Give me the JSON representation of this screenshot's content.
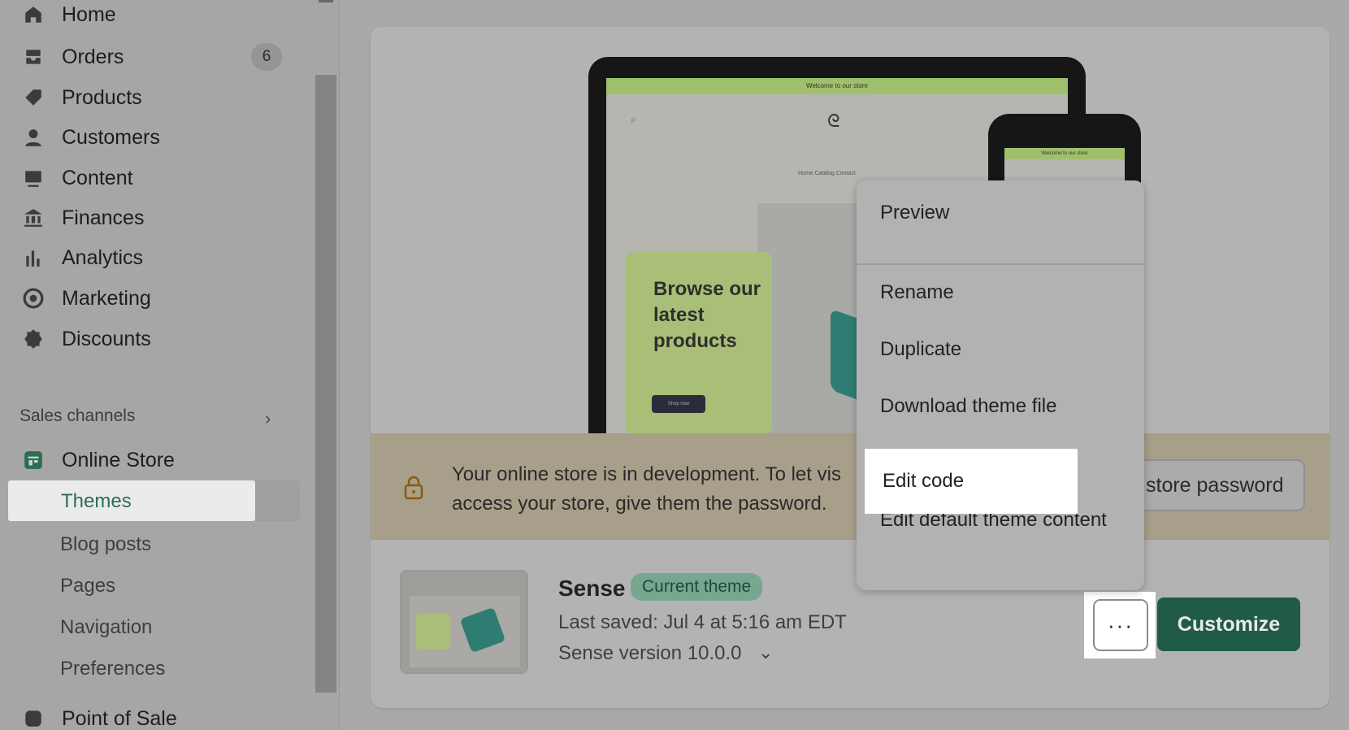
{
  "sidebar": {
    "items": [
      {
        "label": "Home",
        "icon": "home-icon"
      },
      {
        "label": "Orders",
        "icon": "inbox-icon",
        "badge": "6"
      },
      {
        "label": "Products",
        "icon": "tag-icon"
      },
      {
        "label": "Customers",
        "icon": "person-icon"
      },
      {
        "label": "Content",
        "icon": "image-icon"
      },
      {
        "label": "Finances",
        "icon": "bank-icon"
      },
      {
        "label": "Analytics",
        "icon": "bar-chart-icon"
      },
      {
        "label": "Marketing",
        "icon": "target-icon"
      },
      {
        "label": "Discounts",
        "icon": "discount-icon"
      }
    ],
    "sales_channels_label": "Sales channels",
    "online_store_label": "Online Store",
    "sub_items": [
      "Themes",
      "Blog posts",
      "Pages",
      "Navigation",
      "Preferences"
    ],
    "cut_off_item": "Point of Sale"
  },
  "preview": {
    "banner_text": "Welcome to our store",
    "phone_banner_text": "Welcome to our store",
    "nav_text": "Home   Catalog   Contact",
    "promo_text": "Browse our latest products",
    "shop_button": "Shop now"
  },
  "dev_banner": {
    "text_line1": "Your online store is in development. To let vis",
    "text_line2": "access your store, give them the password.",
    "button_label": "store password"
  },
  "theme": {
    "name": "Sense",
    "badge": "Current theme",
    "last_saved": "Last saved: Jul 4 at 5:16 am EDT",
    "version": "Sense version 10.0.0",
    "more_label": "···",
    "customize_label": "Customize"
  },
  "menu": {
    "preview": "Preview",
    "rename": "Rename",
    "duplicate": "Duplicate",
    "download": "Download theme file",
    "edit_code": "Edit code",
    "edit_default": "Edit default theme content"
  },
  "colors": {
    "accent": "#1f5b45",
    "themes_text": "#2b6e52",
    "badge_bg": "#77a790"
  }
}
